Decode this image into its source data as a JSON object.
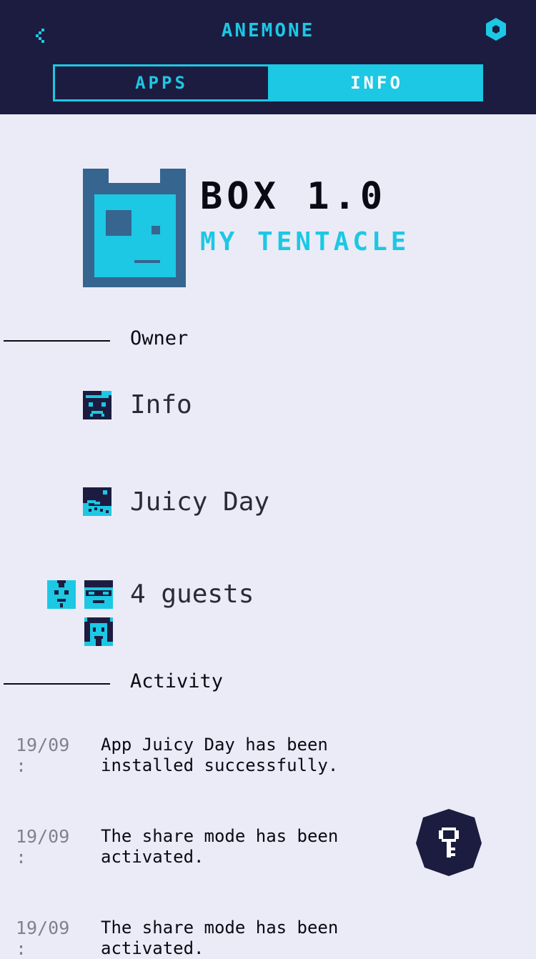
{
  "header": {
    "title": "Anemone",
    "back_icon": "chevron-left-icon",
    "settings_icon": "hexagon-settings-icon",
    "accent": "#1cc8e4",
    "background": "#1c1c40"
  },
  "tabs": [
    {
      "label": "Apps",
      "selected": false
    },
    {
      "label": "Info",
      "selected": true
    }
  ],
  "box": {
    "title": "Box 1.0",
    "subtitle": "My tentacle",
    "avatar_icon": "box-robot-face-icon"
  },
  "sections": {
    "owner": "Owner",
    "activity": "Activity"
  },
  "owner_rows": [
    {
      "label": "Info",
      "icon": "sad-face-icon"
    },
    {
      "label": "Juicy Day",
      "icon": "wave-app-icon"
    },
    {
      "label": "4 guests",
      "icons": [
        "guest-mohawk-icon",
        "guest-sunglasses-icon",
        "guest-long-hair-icon"
      ]
    }
  ],
  "activity": [
    {
      "date": "19/09\n:",
      "text": "App Juicy Day has been installed successfully."
    },
    {
      "date": "19/09\n:",
      "text": "The share mode has been activated."
    },
    {
      "date": "19/09\n:",
      "text": "The share mode has been activated."
    }
  ],
  "fab": {
    "icon": "key-icon",
    "background": "#1c1c40"
  }
}
